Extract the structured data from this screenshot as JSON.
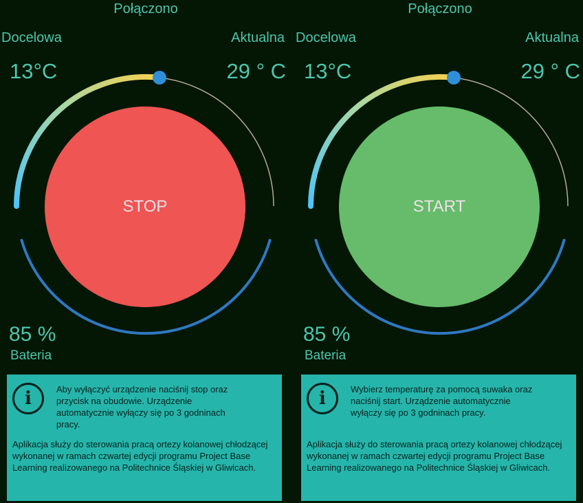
{
  "screens": [
    {
      "status": "Połączono",
      "target_label": "Docelowa",
      "current_label": "Aktualna",
      "target_temp": "13°C",
      "current_temp": "29 ° C",
      "button_label": "STOP",
      "battery_value": "85 %",
      "battery_label": "Bateria",
      "info_main": "Aby wyłączyć urządzenie naciśnij stop oraz przycisk na obudowie. Urządzenie automatycznie wyłączy się po 3 godninach pracy.",
      "info_desc": "Aplikacja służy do sterowania pracą ortezy kolanowej chłodzącej wykonanej w ramach czwartej edycji programu Project Base Learning realizowanego na Politechnice Śląskiej w Gliwicach.",
      "button_color": "#ef5553"
    },
    {
      "status": "Połączono",
      "target_label": "Docelowa",
      "current_label": "Aktualna",
      "target_temp": "13°C",
      "current_temp": "29 ° C",
      "button_label": "START",
      "battery_value": "85 %",
      "battery_label": "Bateria",
      "info_main": "Wybierz temperaturę za pomocą suwaka oraz naciśnij start. Urządzenie automatycznie wyłączy się po 3 godninach pracy.",
      "info_desc": "Aplikacja służy do sterowania pracą ortezy kolanowej chłodzącej wykonanej w ramach czwartej edycji programu Project Base Learning realizowanego na Politechnice Śląskiej w Gliwicach.",
      "button_color": "#66bc6a"
    }
  ],
  "info_icon_glyph": "i",
  "theme": {
    "background": "#041604",
    "accent_text": "#4cc6ad",
    "slider_thumb": "#2f8fd8",
    "battery_arc": "#2f78c1",
    "gradient_start": "#4fc3f7",
    "gradient_end": "#f6d04d",
    "info_box": "#26b5ab"
  }
}
